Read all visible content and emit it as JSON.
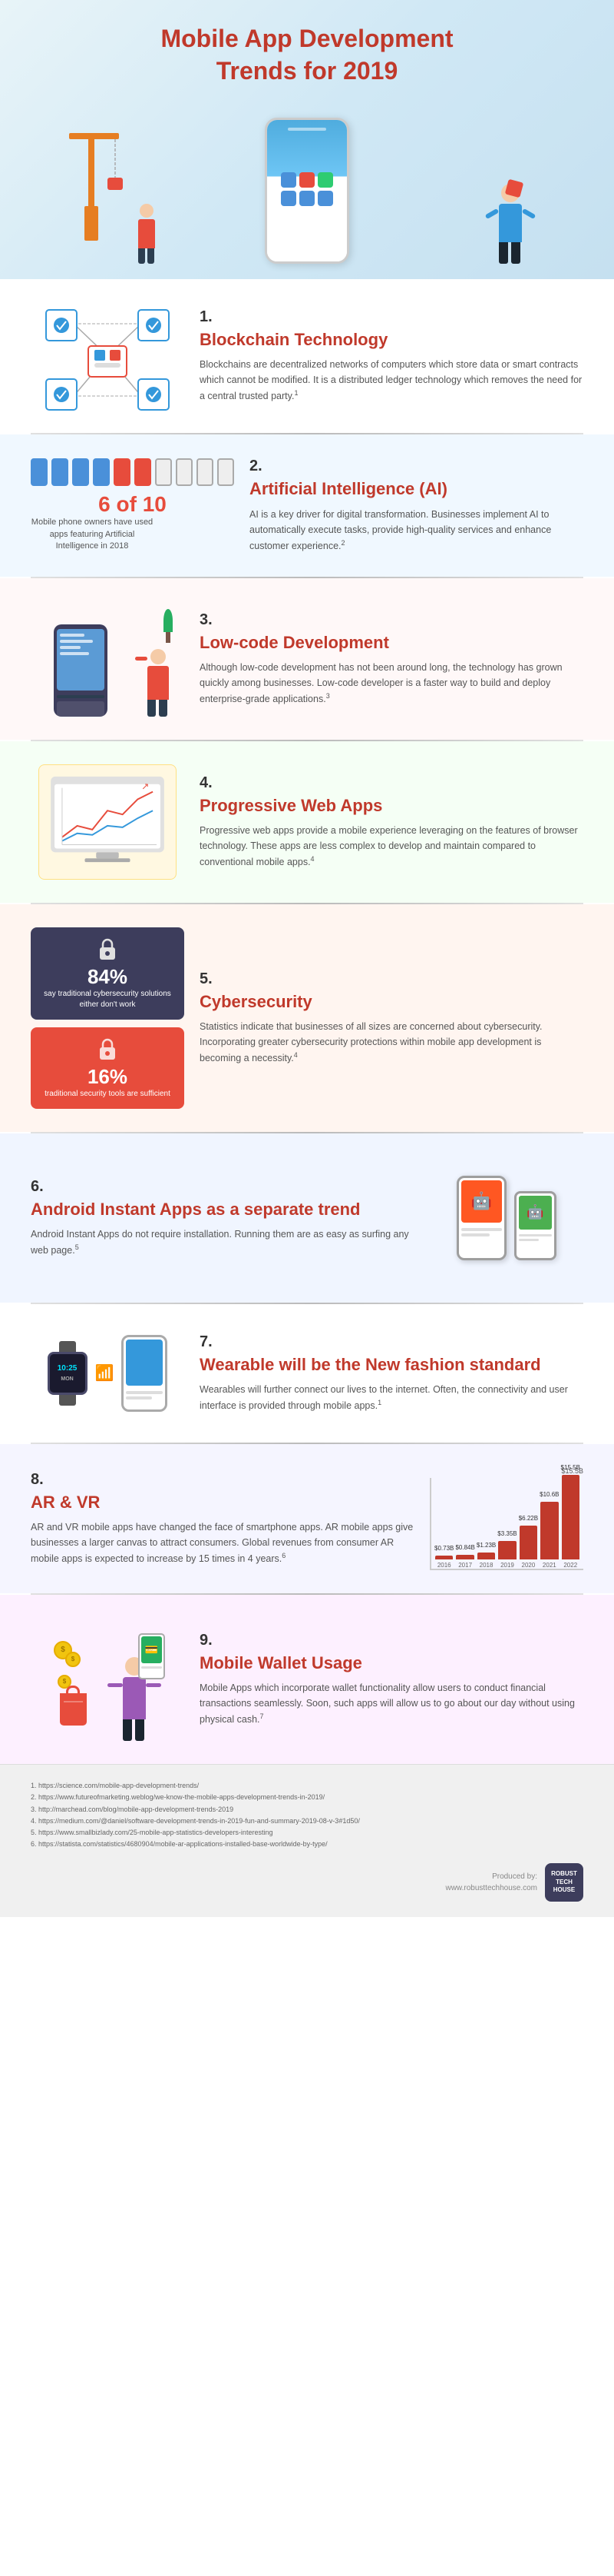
{
  "header": {
    "title": "Mobile App Development\nTrends for 2019"
  },
  "sections": [
    {
      "id": "blockchain",
      "number": "1.",
      "title": "Blockchain Technology",
      "description": "Blockchains are decentralized networks of computers which store data or smart contracts which cannot be modified. It is a distributed ledger technology which removes the need for a central trusted party.",
      "ref": "1"
    },
    {
      "id": "ai",
      "number": "2.",
      "title": "Artificial Intelligence (AI)",
      "description": "AI is a key driver for digital transformation. Businesses implement AI to automatically execute tasks, provide high-quality services and enhance customer experience.",
      "ref": "2",
      "stat": "6 of 10",
      "stat_label": "Mobile phone owners have used apps featuring Artificial Intelligence in 2018"
    },
    {
      "id": "lowcode",
      "number": "3.",
      "title": "Low-code Development",
      "description": "Although low-code development has not been around long, the technology has grown quickly among businesses. Low-code developer is a faster way to build and deploy enterprise-grade applications.",
      "ref": "3"
    },
    {
      "id": "pwa",
      "number": "4.",
      "title": "Progressive Web Apps",
      "description": "Progressive web apps provide a mobile experience leveraging on the features of browser technology. These apps are less complex to develop and maintain compared to conventional mobile apps.",
      "ref": "4"
    },
    {
      "id": "cyber",
      "number": "5.",
      "title": "Cybersecurity",
      "description": "Statistics indicate that businesses of all sizes are concerned about cybersecurity. Incorporating greater cybersecurity protections within mobile app development is becoming a necessity.",
      "ref": "4",
      "stat1_pct": "84%",
      "stat1_label": "say traditional cybersecurity solutions either don't work",
      "stat2_pct": "16%",
      "stat2_label": "traditional security tools are sufficient"
    },
    {
      "id": "android",
      "number": "6.",
      "title": "Android Instant Apps as a separate trend",
      "description": "Android Instant Apps do not require installation. Running them are as easy as surfing any web page.",
      "ref": "5"
    },
    {
      "id": "wearable",
      "number": "7.",
      "title": "Wearable will be the New fashion standard",
      "description": "Wearables will further connect our lives to the internet. Often, the connectivity and user interface is provided through mobile apps.",
      "ref": "1"
    },
    {
      "id": "arvr",
      "number": "8.",
      "title": "AR & VR",
      "description": "AR and VR mobile apps have changed the face of smartphone apps. AR mobile apps give businesses a larger canvas to attract consumers. Global revenues from consumer AR mobile apps is expected to increase by 15 times in 4 years.",
      "ref": "6",
      "chart": {
        "title": "$15.5B",
        "bars": [
          {
            "year": "2016",
            "value": 0.738,
            "label": "$0.73B"
          },
          {
            "year": "2017",
            "value": 0.848,
            "label": "$0.84B"
          },
          {
            "year": "2018",
            "value": 1.23,
            "label": "$1.23B"
          },
          {
            "year": "2019",
            "value": 3.35,
            "label": "$3.35B"
          },
          {
            "year": "2020",
            "value": 6.22,
            "label": "$6.22B"
          },
          {
            "year": "2021",
            "value": 10.6,
            "label": "$10.6B"
          },
          {
            "year": "2022",
            "value": 15.5,
            "label": "$15.5B"
          }
        ],
        "max": 15.5
      }
    },
    {
      "id": "wallet",
      "number": "9.",
      "title": "Mobile Wallet Usage",
      "description": "Mobile Apps which incorporate wallet functionality allow users to conduct financial transactions seamlessly. Soon, such apps will allow us to go about our day without using physical cash.",
      "ref": "7"
    }
  ],
  "footer": {
    "refs": [
      "1. https://science.com/mobile-app-development-trends/",
      "2. https://www.futureofmarketing.weblog/we-know-the-mobile-apps-development-trends-in-2019/",
      "3. http://marchead.com/blog/mobile-app-development-trends-2019",
      "4. https://medium.com/@daniel/software-development-trends-in-2019-fun-and-summary-2019-08-v-3#1d50/",
      "5. https://www.smallbizlady.com/25-mobile-app-statistics-developers-interesting",
      "6. https://statista.com/statistics/4680904/mobile-ar-applications-installed-base-worldwide-by-type/"
    ],
    "produced_by": "Produced by:",
    "brand": "ROBUST\nTECH\nHOUSE",
    "url": "www.robusttechhouse.com"
  }
}
